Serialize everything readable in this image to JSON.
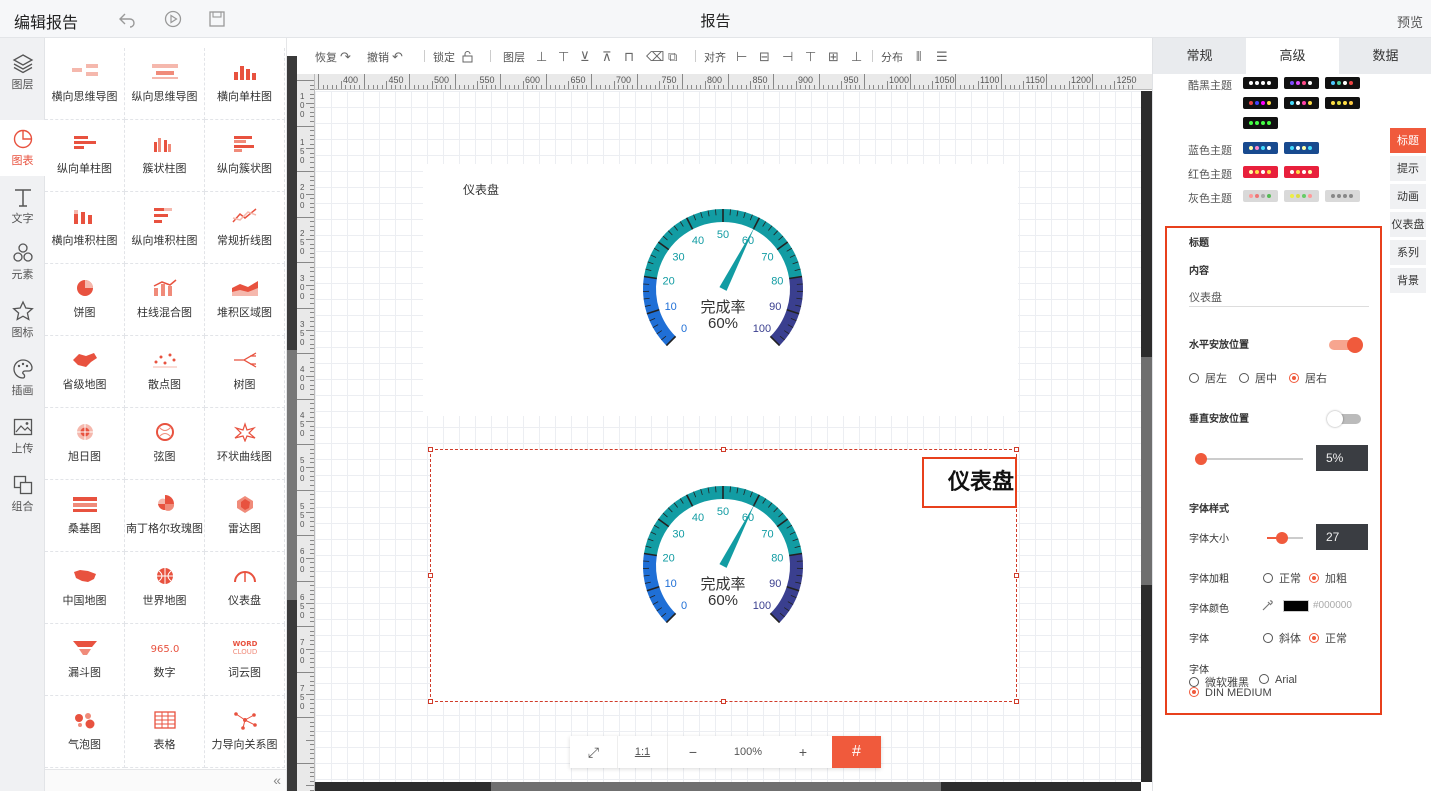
{
  "header": {
    "app_title": "编辑报告",
    "report_title": "报告",
    "preview_label": "预览"
  },
  "rail": [
    {
      "label": "图层",
      "icon": "layers-icon"
    },
    {
      "label": "图表",
      "icon": "chart-icon",
      "active": true
    },
    {
      "label": "文字",
      "icon": "text-icon"
    },
    {
      "label": "元素",
      "icon": "elements-icon"
    },
    {
      "label": "图标",
      "icon": "star-icon"
    },
    {
      "label": "插画",
      "icon": "palette-icon"
    },
    {
      "label": "上传",
      "icon": "upload-image-icon"
    },
    {
      "label": "组合",
      "icon": "group-icon"
    }
  ],
  "palette": [
    "横向思维导图",
    "纵向思维导图",
    "横向单柱图",
    "纵向单柱图",
    "簇状柱图",
    "纵向簇状图",
    "横向堆积柱图",
    "纵向堆积柱图",
    "常规折线图",
    "饼图",
    "柱线混合图",
    "堆积区域图",
    "省级地图",
    "散点图",
    "树图",
    "旭日图",
    "弦图",
    "环状曲线图",
    "桑基图",
    "南丁格尔玫瑰图",
    "雷达图",
    "中国地图",
    "世界地图",
    "仪表盘",
    "漏斗图",
    "数字",
    "词云图",
    "气泡图",
    "表格",
    "力导向关系图"
  ],
  "canvas_toolbar": {
    "redo": "恢复",
    "undo": "撤销",
    "lock": "锁定",
    "layer": "图层",
    "align": "对齐",
    "distribute": "分布"
  },
  "ruler_h": [
    "400",
    "450",
    "500",
    "550",
    "600",
    "650",
    "700",
    "750",
    "800",
    "850",
    "900",
    "950",
    "1000",
    "1050",
    "1100",
    "1150",
    "1200",
    "1250"
  ],
  "ruler_v": [
    "100",
    "150",
    "200",
    "250",
    "300",
    "350",
    "400",
    "450",
    "500",
    "550",
    "600",
    "650",
    "700",
    "750"
  ],
  "widgets": [
    {
      "title": "仪表盘",
      "gauge_label": "完成率",
      "gauge_value": "60%"
    },
    {
      "title": "仪表盘",
      "gauge_label": "完成率",
      "gauge_value": "60%"
    }
  ],
  "gauge": {
    "min": 0,
    "max": 100,
    "value": 60,
    "ticks": [
      "0",
      "10",
      "20",
      "30",
      "40",
      "50",
      "60",
      "70",
      "80",
      "90",
      "100"
    ]
  },
  "zoom": {
    "fit": "⤢",
    "one_to_one": "1:1",
    "minus": "−",
    "level": "100%",
    "plus": "+",
    "grid": "#"
  },
  "right_panel": {
    "tabs": [
      "常规",
      "高级",
      "数据"
    ],
    "active_tab": "高级",
    "themes": [
      {
        "label": "酷黑主题"
      },
      {
        "label": "蓝色主题"
      },
      {
        "label": "红色主题"
      },
      {
        "label": "灰色主题"
      }
    ],
    "vtabs": [
      "标题",
      "提示",
      "动画",
      "仪表盘",
      "系列",
      "背景"
    ],
    "title_section": {
      "heading": "标题",
      "content_label": "内容",
      "content_value": "仪表盘",
      "h_position_label": "水平安放位置",
      "h_options": [
        "居左",
        "居中",
        "居右"
      ],
      "v_position_label": "垂直安放位置",
      "v_value": "5%",
      "font_style_label": "字体样式",
      "font_size_label": "字体大小",
      "font_size_value": "27",
      "bold_label": "字体加粗",
      "bold_options": [
        "正常",
        "加粗"
      ],
      "color_label": "字体颜色",
      "color_value": "#000000",
      "italic_label": "字体",
      "italic_options": [
        "斜体",
        "正常"
      ],
      "family_label": "字体",
      "family_options": [
        "微软雅黑",
        "Arial",
        "DIN MEDIUM"
      ]
    }
  },
  "colors": {
    "accent": "#f05a3c",
    "gauge_teal": "#129ca3",
    "gauge_blue": "#1f6fd6",
    "gauge_navy": "#3a3f8f"
  }
}
